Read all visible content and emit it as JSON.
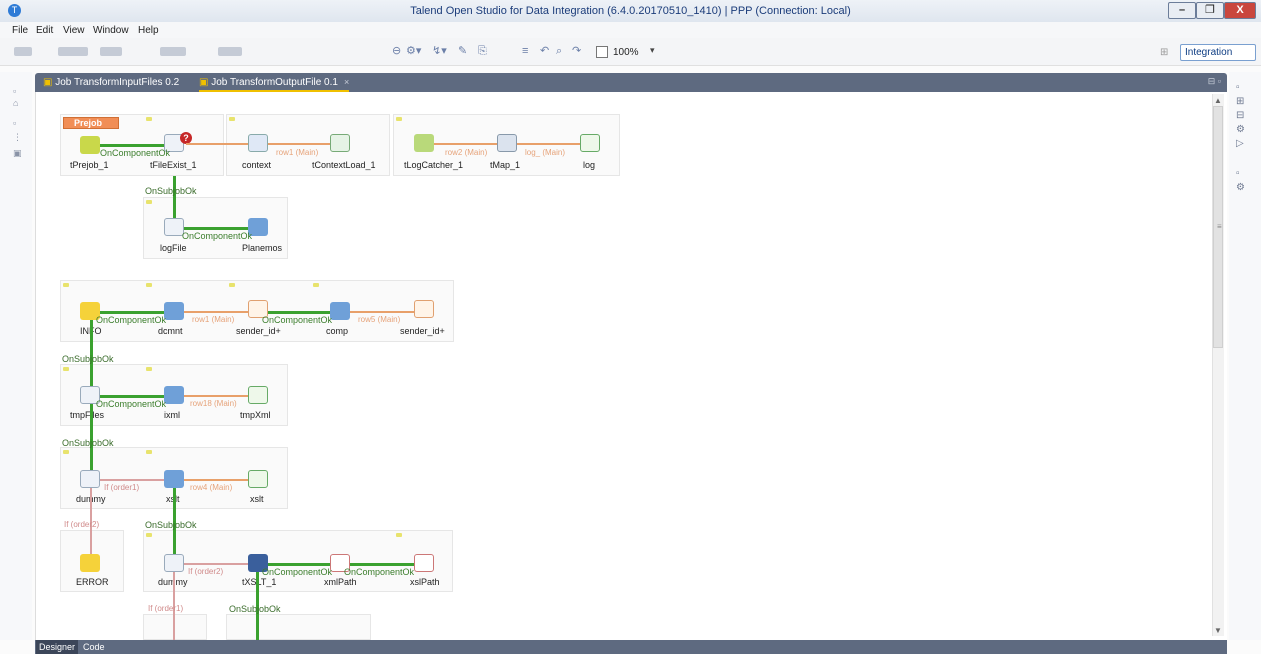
{
  "window": {
    "title": "Talend Open Studio for Data Integration (6.4.0.20170510_1410) | PPP (Connection: Local)",
    "controls": {
      "minimize": "–",
      "restore": "❐",
      "close": "X"
    }
  },
  "menu": {
    "items": [
      "File",
      "Edit",
      "View",
      "Window",
      "Help"
    ]
  },
  "toolbar": {
    "zoom": "100%",
    "perspective": "Integration"
  },
  "tabs": [
    {
      "label": "Job TransformInputFiles 0.2",
      "active": false
    },
    {
      "label": "Job TransformOutputFile 0.1",
      "active": true,
      "close": "×"
    }
  ],
  "bottom_tabs": [
    "Designer",
    "Code"
  ],
  "job": {
    "prejob_label": "Prejob",
    "components": {
      "tPrejob_1": "tPrejob_1",
      "tFileExist_1": "tFileExist_1",
      "context": "context",
      "tContextLoad_1": "tContextLoad_1",
      "tLogCatcher_1": "tLogCatcher_1",
      "tMap_1": "tMap_1",
      "log": "log",
      "logFile": "logFile",
      "Planemos": "Planemos",
      "INFO": "INFO",
      "dcmnt": "dcmnt",
      "sender_id_1": "sender_id+",
      "comp": "comp",
      "sender_id_2": "sender_id+",
      "tmpFiles": "tmpFiles",
      "ixml": "ixml",
      "tmpXml": "tmpXml",
      "dummy_1": "dummy",
      "xslt_1": "xslt",
      "xslt_2": "xslt",
      "ERROR": "ERROR",
      "dummy_2": "dummy",
      "tXSLT_1": "tXSLT_1",
      "xmlPath": "xmlPath",
      "xslPath": "xslPath"
    },
    "links": {
      "oncomponentok": "OnComponentOk",
      "onsubjobok": "OnSubjobOk",
      "if_order1": "If (order1)",
      "if_order2": "If (order2)",
      "row2": "row2 (Main)",
      "row_log": "log_ (Main)",
      "row1": "row1 (Main)",
      "row5": "row5 (Main)",
      "row18": "row18 (Main)",
      "row4": "row4 (Main)"
    }
  },
  "icons": {
    "app": "talend-logo-icon",
    "tprejob": "prejob-icon",
    "tfileexist": "file-exist-icon",
    "context": "context-icon",
    "contextload": "context-load-icon",
    "logcatcher": "log-catcher-icon",
    "tmap": "tmap-icon",
    "log": "log-output-icon",
    "db": "database-icon",
    "warn": "warning-icon",
    "file": "file-icon"
  },
  "colors": {
    "tab_strip": "#5e6a80",
    "prejob": "#f18e56",
    "link_ok": "#3aa12f",
    "link_row": "#e8a06a",
    "link_if": "#d9a0a0"
  }
}
